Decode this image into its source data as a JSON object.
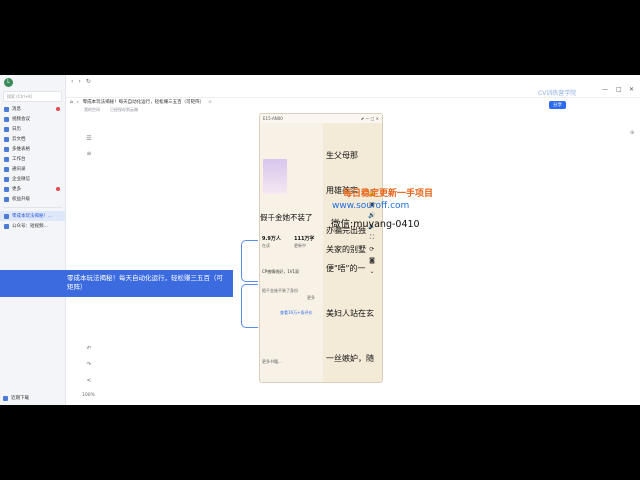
{
  "sidebar": {
    "avatar": "L",
    "search_placeholder": "搜索 (Ctrl+K)",
    "items": [
      {
        "label": "消息",
        "badge": true
      },
      {
        "label": "视频会议",
        "badge": false
      },
      {
        "label": "日历",
        "badge": false
      },
      {
        "label": "云文档",
        "badge": false
      },
      {
        "label": "多维表格",
        "badge": false
      },
      {
        "label": "工作台",
        "badge": false
      },
      {
        "label": "通讯录",
        "badge": false
      },
      {
        "label": "企业微信",
        "badge": false
      },
      {
        "label": "更多",
        "badge": true
      },
      {
        "label": "权益升级",
        "badge": false
      }
    ],
    "docs": [
      {
        "label": "零成本玩法揭秘！..."
      },
      {
        "label": "公众号：短视频..."
      }
    ],
    "bottom": "近期下载"
  },
  "header": {
    "title": "零成本玩法揭秘！每天自动化运行，轻松赚三五百（可矩阵）",
    "sub_left": "我的空间",
    "sub_right": "已经保存到云端",
    "share": "分享",
    "watermark": "CV训练营学院"
  },
  "mindmap": {
    "root": "零成本玩法揭秘！每天自动化运行，轻松赚三五百（可矩阵）"
  },
  "phone": {
    "app": "E15-AN00",
    "book_title": "假千金她不装了",
    "stats": [
      {
        "value": "9.9万人",
        "label": "在读"
      },
      {
        "value": "111万字",
        "label": "更新中"
      }
    ],
    "tags": "CP感情线好，1V1双",
    "line1": "假千金她不装了身份",
    "line2": "更多",
    "line3": "查看16万+条评价",
    "bottom_text": "更多书籍..."
  },
  "reader": {
    "lines": [
      "生父母那",
      "用雄孩实",
      "办骗完出独",
      "关家的别墅",
      "便\"唔\"的一",
      "美妇人站在玄",
      "一丝嫉妒，随"
    ]
  },
  "overlay": {
    "line1": "每日稳定更新一手项目",
    "line2": "www.souroff.com",
    "line3": "微信:muyang-0410"
  },
  "zoom": "100%"
}
